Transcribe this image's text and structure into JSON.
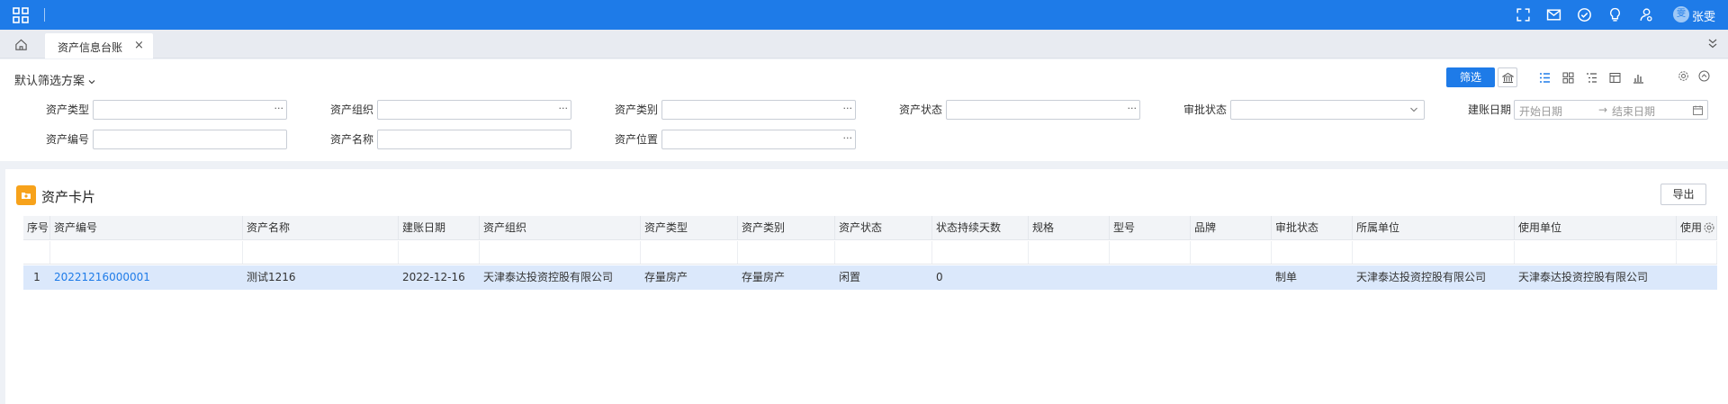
{
  "topbar": {
    "user_name": "张雯",
    "avatar_char": "雯",
    "icons": [
      "apps-grid-icon",
      "fullscreen-icon",
      "mail-icon",
      "check-circle-icon",
      "bulb-icon",
      "user-settings-icon"
    ]
  },
  "tabs": [
    {
      "label": "资产信息台账",
      "close": "×",
      "active": true
    }
  ],
  "filter": {
    "scheme_label": "默认筛选方案",
    "filter_button": "筛选",
    "fields": {
      "asset_type": {
        "label": "资产类型",
        "value": "",
        "dots": "···"
      },
      "asset_org": {
        "label": "资产组织",
        "value": "",
        "dots": "···"
      },
      "asset_category": {
        "label": "资产类别",
        "value": "",
        "dots": "···"
      },
      "asset_status": {
        "label": "资产状态",
        "value": "",
        "dots": "···"
      },
      "approval_status": {
        "label": "审批状态",
        "value": ""
      },
      "account_date": {
        "label": "建账日期",
        "start_placeholder": "开始日期",
        "arrow": "→",
        "end_placeholder": "结束日期"
      },
      "asset_code": {
        "label": "资产编号",
        "value": ""
      },
      "asset_name": {
        "label": "资产名称",
        "value": ""
      },
      "asset_location": {
        "label": "资产位置",
        "value": "",
        "dots": "···"
      }
    }
  },
  "panel": {
    "title": "资产卡片",
    "export_button": "导出"
  },
  "table": {
    "columns": [
      "序号",
      "资产编号",
      "资产名称",
      "建账日期",
      "资产组织",
      "资产类型",
      "资产类别",
      "资产状态",
      "状态持续天数",
      "规格",
      "型号",
      "品牌",
      "审批状态",
      "所属单位",
      "使用单位",
      "使用"
    ],
    "rows": [
      [
        "1",
        "20221216000001",
        "测试1216",
        "2022-12-16",
        "天津泰达投资控股有限公司",
        "存量房产",
        "存量房产",
        "闲置",
        "0",
        "",
        "",
        "",
        "制单",
        "天津泰达投资控股有限公司",
        "天津泰达投资控股有限公司",
        ""
      ]
    ]
  },
  "colors": {
    "primary": "#1e7be8",
    "row_selected": "#dbe8fb",
    "panel_icon": "#f7a21b"
  }
}
